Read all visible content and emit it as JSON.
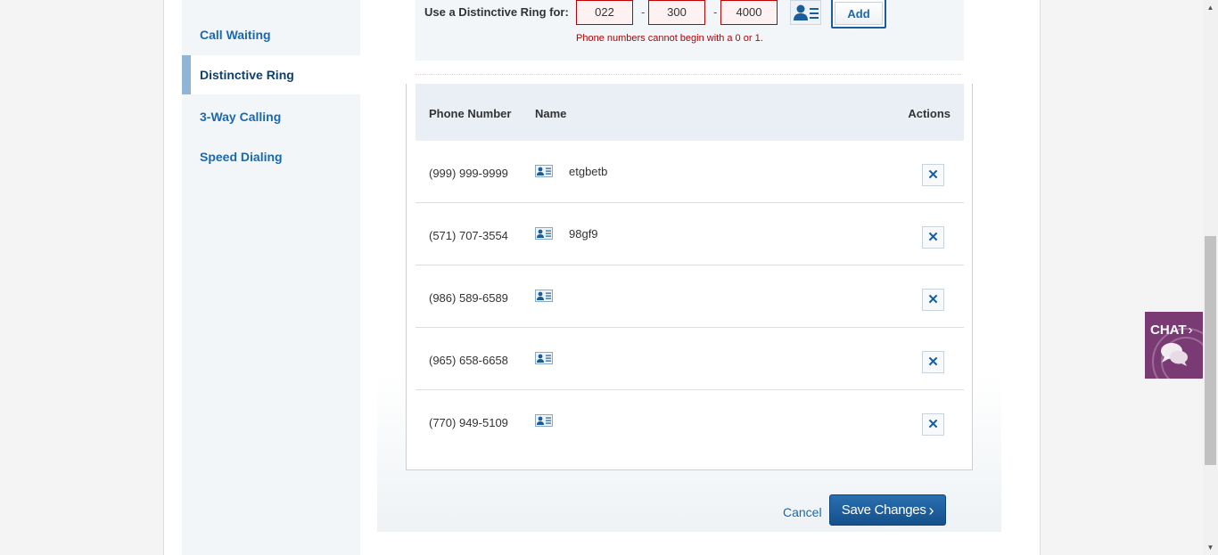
{
  "sidebar": {
    "items": [
      {
        "label": "Call Waiting",
        "active": false
      },
      {
        "label": "Distinctive Ring",
        "active": true
      },
      {
        "label": "3-Way Calling",
        "active": false
      },
      {
        "label": "Speed Dialing",
        "active": false
      }
    ]
  },
  "ring_form": {
    "label": "Use a Distinctive Ring for:",
    "area_code": "022",
    "prefix": "300",
    "line": "4000",
    "separator": "-",
    "add_label": "Add",
    "error": "Phone numbers cannot begin with a 0 or 1."
  },
  "table": {
    "headers": {
      "phone": "Phone Number",
      "name": "Name",
      "actions": "Actions"
    },
    "rows": [
      {
        "phone": "(999) 999-9999",
        "name": "etgbetb"
      },
      {
        "phone": "(571) 707-3554",
        "name": "98gf9"
      },
      {
        "phone": "(986) 589-6589",
        "name": ""
      },
      {
        "phone": "(965) 658-6658",
        "name": ""
      },
      {
        "phone": "(770) 949-5109",
        "name": ""
      }
    ],
    "delete_glyph": "✕"
  },
  "footer": {
    "cancel": "Cancel",
    "save": "Save Changes",
    "save_chevron": "›"
  },
  "chat": {
    "label": "CHAT",
    "chevron": "›"
  },
  "colors": {
    "link": "#1a69b0",
    "error": "#b40000",
    "chat_bg": "#7a3b74",
    "save_bg": "#15508a"
  },
  "icons": {
    "contact": "contact-card-icon",
    "delete": "close-icon",
    "chat": "chat-bubble-icon"
  }
}
